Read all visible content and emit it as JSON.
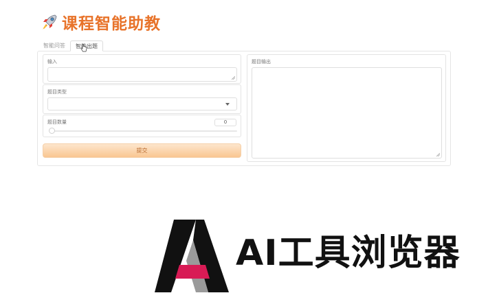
{
  "app": {
    "title": "课程智能助教",
    "icon": "rocket-icon"
  },
  "tabs": [
    {
      "label": "智能问答",
      "active": false
    },
    {
      "label": "智能出题",
      "active": true
    }
  ],
  "form": {
    "input_label": "输入",
    "input_value": "",
    "type_label": "题目类型",
    "type_value": "",
    "count_label": "题目数量",
    "count_value": "0",
    "slider_value": 0,
    "submit_label": "提交"
  },
  "output": {
    "label": "题目输出",
    "value": ""
  },
  "watermark": {
    "text": "AI工具浏览器",
    "colors": {
      "dark": "#111111",
      "accent": "#d81b55",
      "gray": "#888888"
    }
  },
  "colors": {
    "brand": "#e8732a",
    "button_top": "#fde6cd",
    "button_bottom": "#f9c691"
  }
}
